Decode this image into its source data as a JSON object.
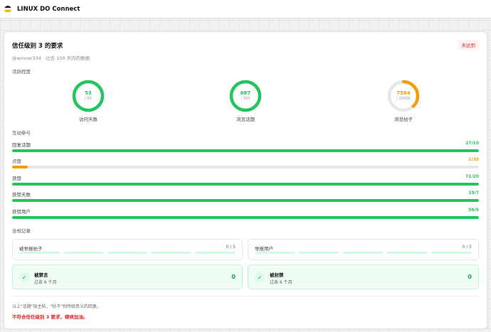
{
  "app": {
    "title": "LINUX DO Connect",
    "logo_colors": [
      "#1c1c1e",
      "#f0f0f0",
      "#f5b400"
    ]
  },
  "card": {
    "title": "信任级别 3 的要求",
    "status_badge": "未达到",
    "subtitle": "@winner334 · 过去 100 天内的数据"
  },
  "activity": {
    "label": "活跃程度",
    "rings": [
      {
        "value": "53",
        "target": "/ 50",
        "label": "访问天数",
        "progress": 1.0,
        "color": "#22c55e"
      },
      {
        "value": "687",
        "target": "/ 500",
        "label": "浏览话题",
        "progress": 1.0,
        "color": "#22c55e"
      },
      {
        "value": "7564",
        "target": "/ 20000",
        "label": "浏览帖子",
        "progress": 0.378,
        "color": "#f59e0b"
      }
    ]
  },
  "interaction": {
    "label": "互动参与",
    "bars": [
      {
        "label": "回复话题",
        "value": "27/10",
        "progress": 1.0,
        "color": "#22c55e"
      },
      {
        "label": "点赞",
        "value": "1/30",
        "progress": 0.033,
        "color": "#f59e0b"
      },
      {
        "label": "获赞",
        "value": "71/20",
        "progress": 1.0,
        "color": "#22c55e"
      },
      {
        "label": "获赞天数",
        "value": "19/7",
        "progress": 1.0,
        "color": "#22c55e"
      },
      {
        "label": "获赞用户",
        "value": "56/5",
        "progress": 1.0,
        "color": "#22c55e"
      }
    ]
  },
  "compliance": {
    "label": "合规记录",
    "reported_posts": {
      "label": "被举报帖子",
      "count": "0 / 5"
    },
    "reporting_users": {
      "label": "举报用户",
      "count": "0 / 5"
    },
    "silenced": {
      "title": "被禁言",
      "sub": "过去 6 个月",
      "value": "0"
    },
    "suspended": {
      "title": "被封禁",
      "sub": "过去 6 个月",
      "value": "0"
    }
  },
  "footer": {
    "note": "以上\"话题\"指主帖，\"帖子\"则传统意义的回复。",
    "result": "不符合信任级别 3 要求，继续加油。"
  }
}
